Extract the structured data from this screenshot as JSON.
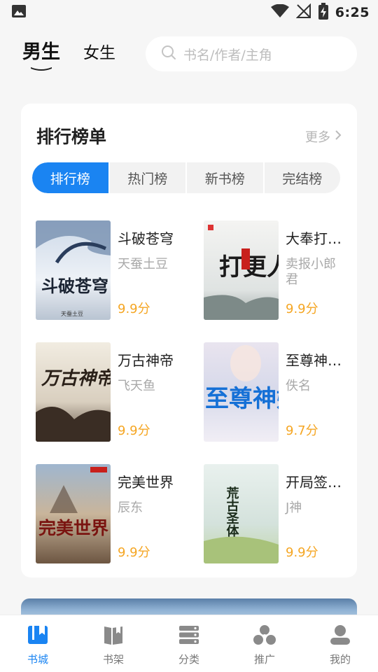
{
  "status_bar": {
    "time": "6:25"
  },
  "header": {
    "tabs": [
      {
        "label": "男生",
        "active": true
      },
      {
        "label": "女生",
        "active": false
      }
    ],
    "search": {
      "placeholder": "书名/作者/主角"
    }
  },
  "ranking": {
    "title": "排行榜单",
    "more_label": "更多",
    "tabs": [
      {
        "label": "排行榜",
        "active": true
      },
      {
        "label": "热门榜",
        "active": false
      },
      {
        "label": "新书榜",
        "active": false
      },
      {
        "label": "完结榜",
        "active": false
      }
    ],
    "books": [
      {
        "title": "斗破苍穹",
        "author": "天蚕土豆",
        "score": "9.9分",
        "cover_text": "斗破苍穹"
      },
      {
        "title": "大奉打…",
        "author": "卖报小郎君",
        "score": "9.9分",
        "cover_text": "打更人"
      },
      {
        "title": "万古神帝",
        "author": "飞天鱼",
        "score": "9.9分",
        "cover_text": "万古神帝"
      },
      {
        "title": "至尊神…",
        "author": "佚名",
        "score": "9.7分",
        "cover_text": "至尊神婿"
      },
      {
        "title": "完美世界",
        "author": "辰东",
        "score": "9.9分",
        "cover_text": "完美世界"
      },
      {
        "title": "开局签…",
        "author": "J神",
        "score": "9.9分",
        "cover_text": "荒古圣体"
      }
    ]
  },
  "bottom_nav": [
    {
      "label": "书城",
      "icon": "book-store-icon",
      "active": true
    },
    {
      "label": "书架",
      "icon": "bookshelf-icon",
      "active": false
    },
    {
      "label": "分类",
      "icon": "category-icon",
      "active": false
    },
    {
      "label": "推广",
      "icon": "promote-icon",
      "active": false
    },
    {
      "label": "我的",
      "icon": "profile-icon",
      "active": false
    }
  ],
  "colors": {
    "accent": "#1a84f2",
    "score": "#f5a623"
  }
}
